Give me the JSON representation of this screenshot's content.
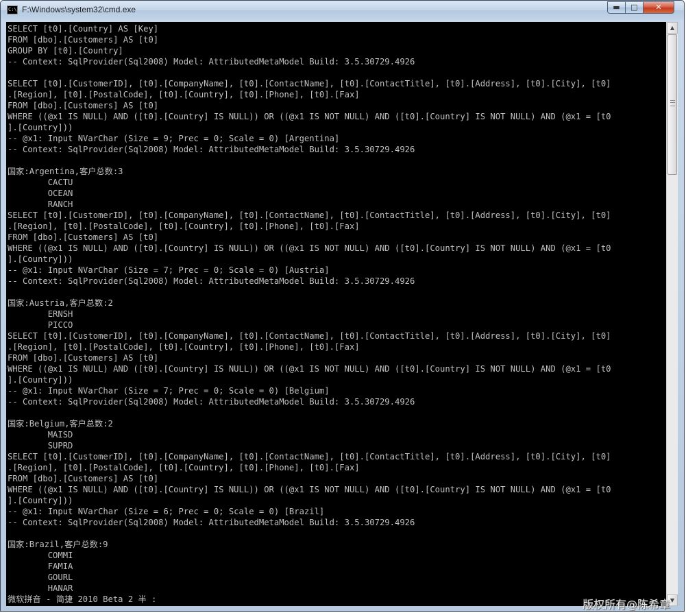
{
  "window": {
    "title": "F:\\Windows\\system32\\cmd.exe",
    "app_icon_text": "C:\\",
    "controls": {
      "minimize": "▬",
      "maximize": "□",
      "close": "✕"
    }
  },
  "console": {
    "lines": [
      "SELECT [t0].[Country] AS [Key]",
      "FROM [dbo].[Customers] AS [t0]",
      "GROUP BY [t0].[Country]",
      "-- Context: SqlProvider(Sql2008) Model: AttributedMetaModel Build: 3.5.30729.4926",
      "",
      "SELECT [t0].[CustomerID], [t0].[CompanyName], [t0].[ContactName], [t0].[ContactTitle], [t0].[Address], [t0].[City], [t0]",
      ".[Region], [t0].[PostalCode], [t0].[Country], [t0].[Phone], [t0].[Fax]",
      "FROM [dbo].[Customers] AS [t0]",
      "WHERE ((@x1 IS NULL) AND ([t0].[Country] IS NULL)) OR ((@x1 IS NOT NULL) AND ([t0].[Country] IS NOT NULL) AND (@x1 = [t0",
      "].[Country]))",
      "-- @x1: Input NVarChar (Size = 9; Prec = 0; Scale = 0) [Argentina]",
      "-- Context: SqlProvider(Sql2008) Model: AttributedMetaModel Build: 3.5.30729.4926",
      "",
      "国家:Argentina,客户总数:3",
      "        CACTU",
      "        OCEAN",
      "        RANCH",
      "SELECT [t0].[CustomerID], [t0].[CompanyName], [t0].[ContactName], [t0].[ContactTitle], [t0].[Address], [t0].[City], [t0]",
      ".[Region], [t0].[PostalCode], [t0].[Country], [t0].[Phone], [t0].[Fax]",
      "FROM [dbo].[Customers] AS [t0]",
      "WHERE ((@x1 IS NULL) AND ([t0].[Country] IS NULL)) OR ((@x1 IS NOT NULL) AND ([t0].[Country] IS NOT NULL) AND (@x1 = [t0",
      "].[Country]))",
      "-- @x1: Input NVarChar (Size = 7; Prec = 0; Scale = 0) [Austria]",
      "-- Context: SqlProvider(Sql2008) Model: AttributedMetaModel Build: 3.5.30729.4926",
      "",
      "国家:Austria,客户总数:2",
      "        ERNSH",
      "        PICCO",
      "SELECT [t0].[CustomerID], [t0].[CompanyName], [t0].[ContactName], [t0].[ContactTitle], [t0].[Address], [t0].[City], [t0]",
      ".[Region], [t0].[PostalCode], [t0].[Country], [t0].[Phone], [t0].[Fax]",
      "FROM [dbo].[Customers] AS [t0]",
      "WHERE ((@x1 IS NULL) AND ([t0].[Country] IS NULL)) OR ((@x1 IS NOT NULL) AND ([t0].[Country] IS NOT NULL) AND (@x1 = [t0",
      "].[Country]))",
      "-- @x1: Input NVarChar (Size = 7; Prec = 0; Scale = 0) [Belgium]",
      "-- Context: SqlProvider(Sql2008) Model: AttributedMetaModel Build: 3.5.30729.4926",
      "",
      "国家:Belgium,客户总数:2",
      "        MAISD",
      "        SUPRD",
      "SELECT [t0].[CustomerID], [t0].[CompanyName], [t0].[ContactName], [t0].[ContactTitle], [t0].[Address], [t0].[City], [t0]",
      ".[Region], [t0].[PostalCode], [t0].[Country], [t0].[Phone], [t0].[Fax]",
      "FROM [dbo].[Customers] AS [t0]",
      "WHERE ((@x1 IS NULL) AND ([t0].[Country] IS NULL)) OR ((@x1 IS NOT NULL) AND ([t0].[Country] IS NOT NULL) AND (@x1 = [t0",
      "].[Country]))",
      "-- @x1: Input NVarChar (Size = 6; Prec = 0; Scale = 0) [Brazil]",
      "-- Context: SqlProvider(Sql2008) Model: AttributedMetaModel Build: 3.5.30729.4926",
      "",
      "国家:Brazil,客户总数:9",
      "        COMMI",
      "        FAMIA",
      "        GOURL",
      "        HANAR",
      "微软拼音 - 简捷 2010 Beta 2 半 :"
    ]
  },
  "watermark": "版权所有@陈希章"
}
